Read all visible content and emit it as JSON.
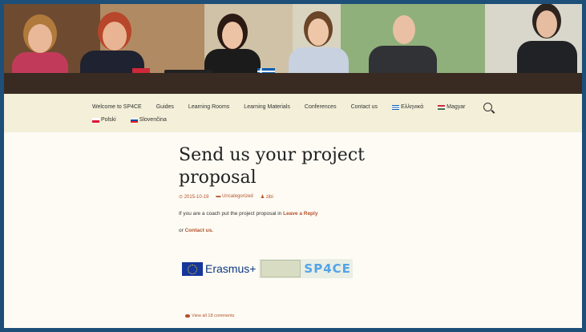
{
  "nav": {
    "row1": [
      {
        "label": "Welcome to SP4CE"
      },
      {
        "label": "Guides"
      },
      {
        "label": "Learning Rooms"
      },
      {
        "label": "Learning Materials"
      },
      {
        "label": "Conferences"
      },
      {
        "label": "Contact us"
      },
      {
        "label": "Ελληνικά",
        "flag": "greece"
      },
      {
        "label": "Magyar",
        "flag": "hungary"
      }
    ],
    "row2": [
      {
        "label": "Polski",
        "flag": "poland"
      },
      {
        "label": "Slovenčina",
        "flag": "slovakia"
      }
    ]
  },
  "post": {
    "title": "Send us your project proposal",
    "date": "2015-10-19",
    "category": "Uncategorized",
    "author": "zibi",
    "para1_text": "If you are a coach put the project proposal in ",
    "para1_link": "Leave a Reply",
    "para2_prefix": "or ",
    "para2_link": "Contact us.",
    "erasmus_text": "Erasmus+",
    "sp4ce_text": "SP4CE",
    "comments_link": "View all 18 comments"
  },
  "colors": {
    "accent": "#b5532b",
    "background": "#1d4f78",
    "nav_bg": "#f3efd8"
  }
}
